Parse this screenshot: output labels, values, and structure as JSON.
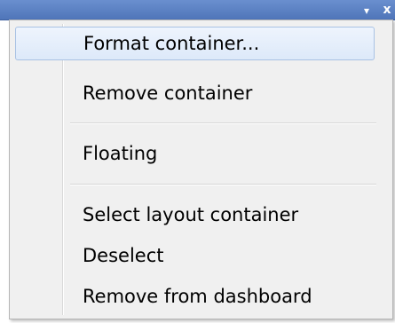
{
  "titlebar": {
    "dropdown_glyph": "▾",
    "close_glyph": "x"
  },
  "menu": {
    "items": [
      {
        "label": "Format container..."
      },
      {
        "label": "Remove container"
      },
      {
        "label": "Floating"
      },
      {
        "label": "Select layout container"
      },
      {
        "label": "Deselect"
      },
      {
        "label": "Remove from dashboard"
      }
    ],
    "highlighted_item": "Format container..."
  },
  "colors": {
    "titlebar": "#5a7fc2",
    "menu_background": "#f0f0f0",
    "highlight_border": "#a9c2e4"
  }
}
